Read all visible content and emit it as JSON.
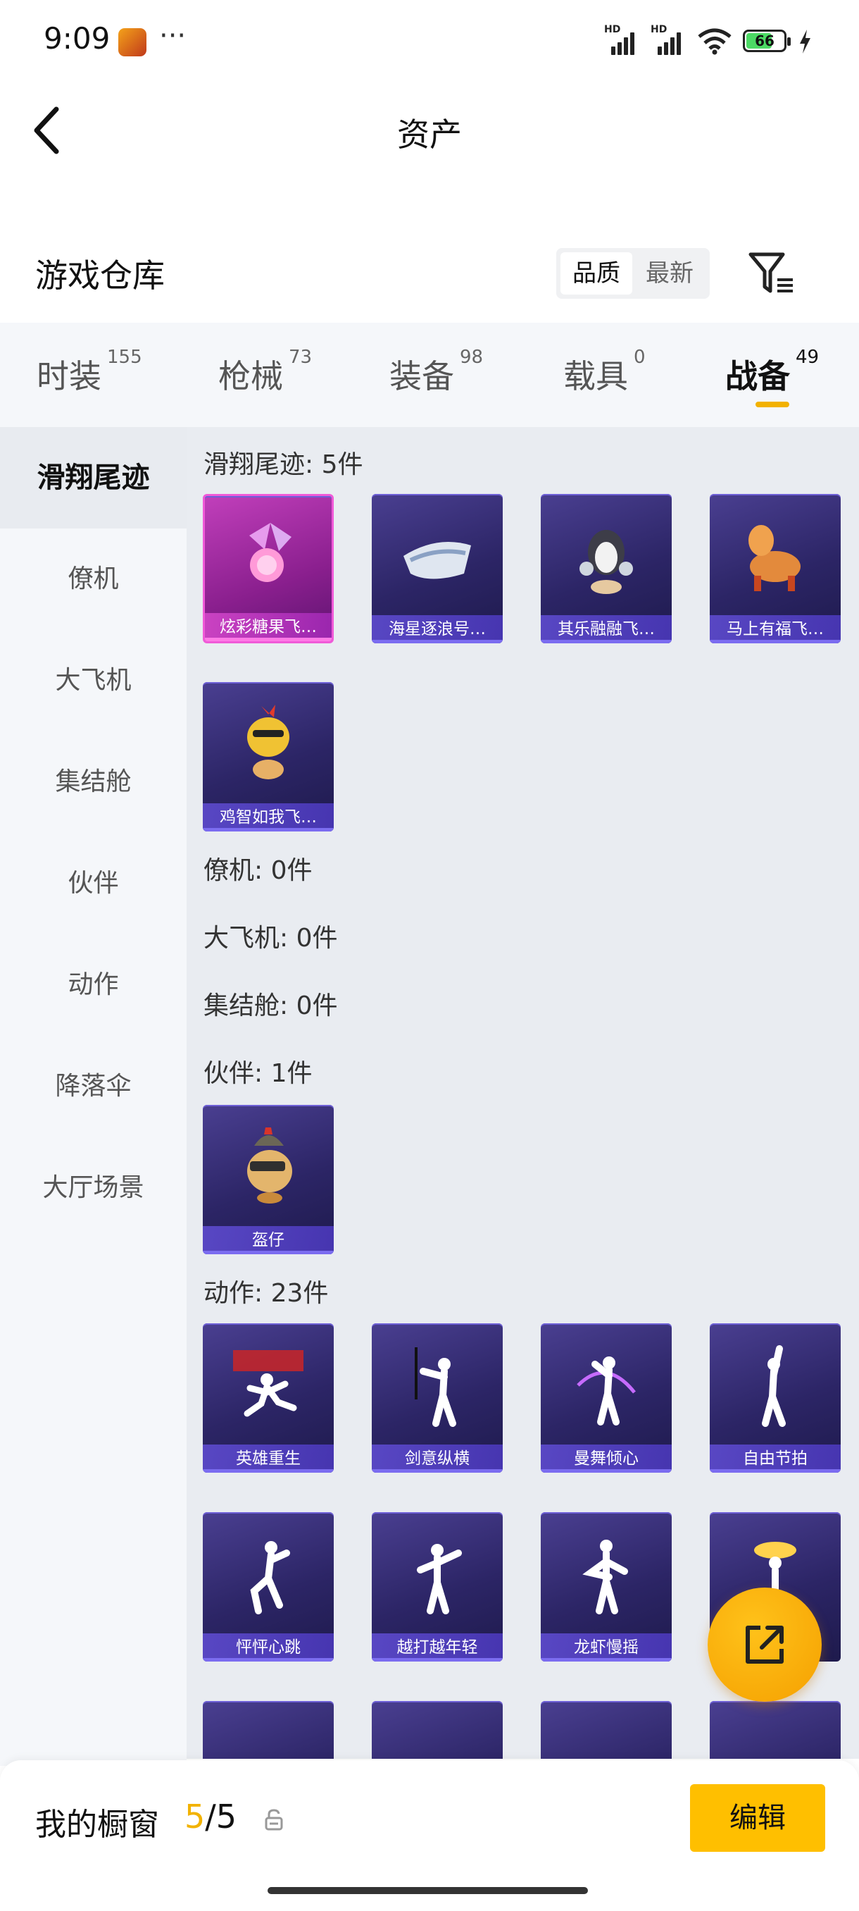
{
  "status_bar": {
    "time": "9:09",
    "dots": "···",
    "battery": "66"
  },
  "header": {
    "title": "资产"
  },
  "section": {
    "title": "游戏仓库",
    "sort_options": [
      "品质",
      "最新"
    ],
    "active_sort": "品质"
  },
  "tabs": [
    {
      "label": "时装",
      "count": "155"
    },
    {
      "label": "枪械",
      "count": "73"
    },
    {
      "label": "装备",
      "count": "98"
    },
    {
      "label": "载具",
      "count": "0"
    },
    {
      "label": "战备",
      "count": "49",
      "active": true
    }
  ],
  "sidebar": {
    "items": [
      "滑翔尾迹",
      "僚机",
      "大飞机",
      "集结舱",
      "伙伴",
      "动作",
      "降落伞",
      "大厅场景"
    ],
    "active": "滑翔尾迹"
  },
  "groups": [
    {
      "title": "滑翔尾迹: 5件",
      "items": [
        "炫彩糖果飞…",
        "海星逐浪号…",
        "其乐融融飞…",
        "马上有福飞…",
        "鸡智如我飞…"
      ]
    },
    {
      "title": "僚机: 0件",
      "items": []
    },
    {
      "title": "大飞机: 0件",
      "items": []
    },
    {
      "title": "集结舱: 0件",
      "items": []
    },
    {
      "title": "伙伴: 1件",
      "items": [
        "盔仔"
      ]
    },
    {
      "title": "动作: 23件",
      "items": [
        "英雄重生",
        "剑意纵横",
        "曼舞倾心",
        "自由节拍",
        "怦怦心跳",
        "越打越年轻",
        "龙虾慢摇"
      ]
    }
  ],
  "showcase": {
    "label": "我的橱窗",
    "current": "5",
    "total": "/5",
    "edit_label": "编辑"
  },
  "colors": {
    "accent": "#f2b200",
    "card_purple": "#2c2566",
    "card_pink": "#8a1f8e"
  }
}
